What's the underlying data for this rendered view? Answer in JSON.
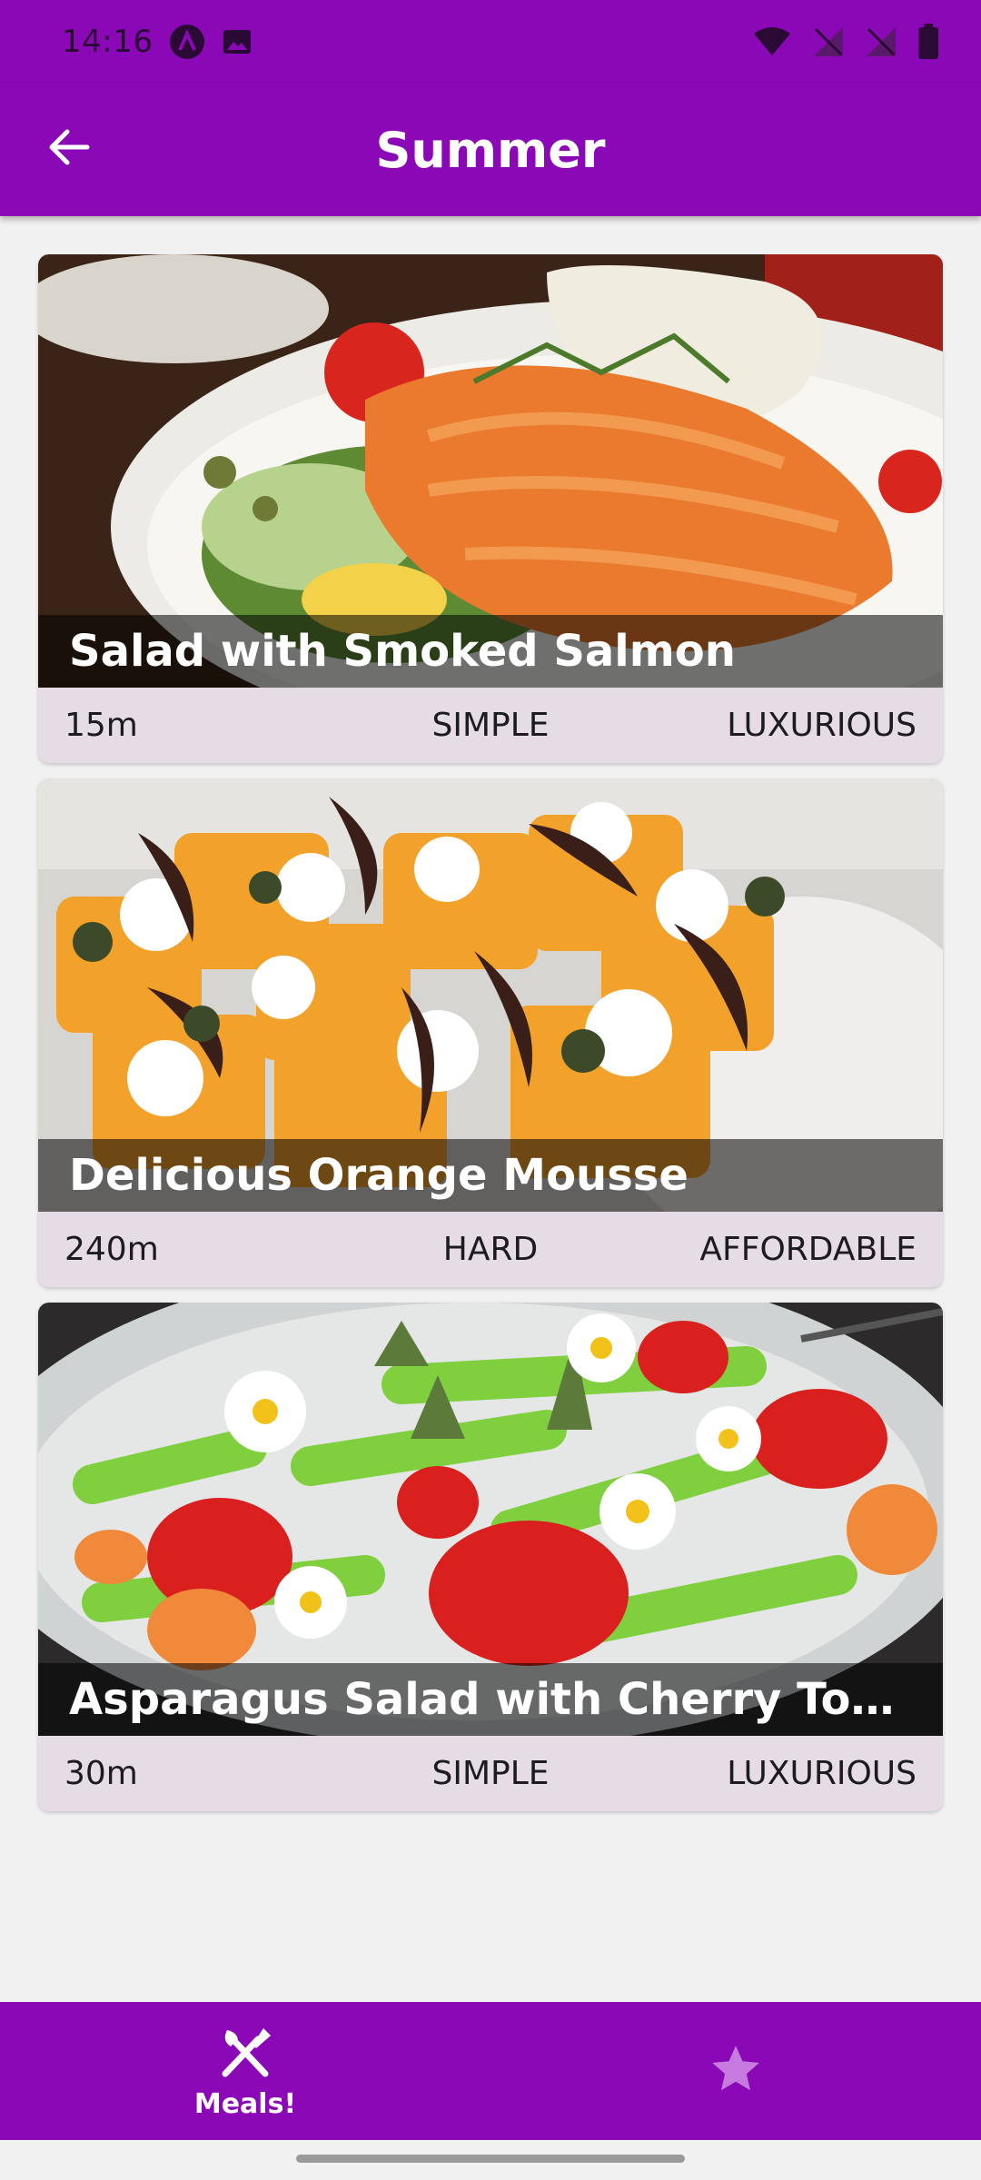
{
  "status_bar": {
    "time": "14:16",
    "icons": [
      "app-a-icon",
      "gallery-icon",
      "wifi-icon",
      "signal-off-icon",
      "signal-off-icon",
      "battery-icon"
    ]
  },
  "app_bar": {
    "title": "Summer",
    "back_icon": "arrow-left-icon"
  },
  "meals": [
    {
      "title": "Salad with Smoked Salmon",
      "duration": "15m",
      "complexity": "SIMPLE",
      "affordability": "LUXURIOUS",
      "image": "smoked-salmon-salad-photo"
    },
    {
      "title": "Delicious Orange Mousse",
      "duration": "240m",
      "complexity": "HARD",
      "affordability": "AFFORDABLE",
      "image": "orange-mousse-photo"
    },
    {
      "title": "Asparagus Salad with Cherry Toma...",
      "duration": "30m",
      "complexity": "SIMPLE",
      "affordability": "LUXURIOUS",
      "image": "asparagus-salad-photo"
    }
  ],
  "bottom_nav": {
    "items": [
      {
        "label": "Meals!",
        "icon": "fork-knife-icon",
        "selected": true
      },
      {
        "label": "",
        "icon": "star-icon",
        "selected": false
      }
    ]
  },
  "colors": {
    "primary": "#8a08b5",
    "background": "#f1f1f1",
    "card_meta_bg": "#e6dce6",
    "inactive_icon": "#c77be0"
  }
}
